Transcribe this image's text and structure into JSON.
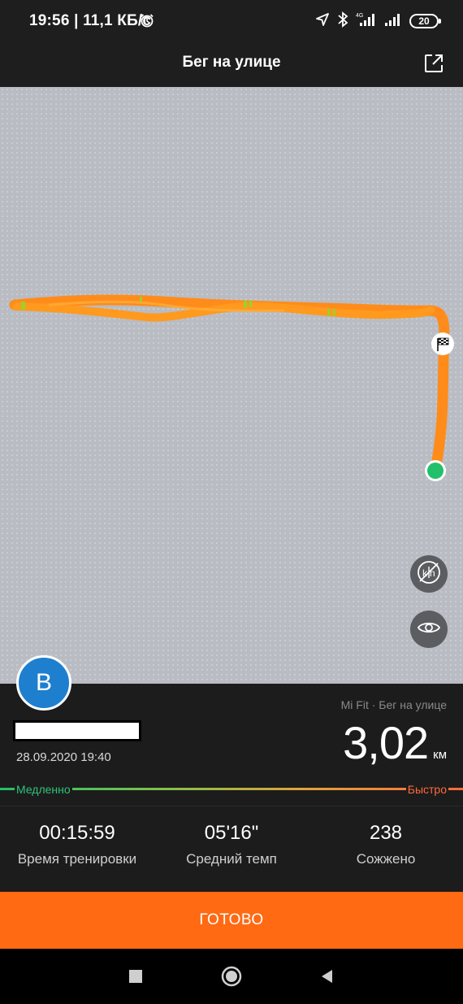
{
  "status_bar": {
    "time": "19:56 | 11,1 КБ/с",
    "battery": "20",
    "icons": [
      "alarm-icon",
      "location-icon",
      "bluetooth-icon",
      "signal-4g-icon",
      "signal-icon",
      "battery-icon"
    ]
  },
  "header": {
    "title": "Бег на улице",
    "share_icon": "share-icon"
  },
  "map": {
    "route_color": "#ff8c1a",
    "start_marker_color": "#22c06a",
    "finish_icon": "checkered-flag-icon",
    "buttons": [
      {
        "icon": "km-markers-off-icon"
      },
      {
        "icon": "eye-icon"
      }
    ]
  },
  "workout": {
    "avatar_letter": "B",
    "date": "28.09.2020 19:40",
    "source": "Mi Fit · Бег на улице",
    "distance": "3,02",
    "distance_unit": "км",
    "pace_slow_label": "Медленно",
    "pace_fast_label": "Быстро",
    "stats": [
      {
        "value": "00:15:59",
        "label": "Время тренировки"
      },
      {
        "value": "05'16\"",
        "label": "Средний темп"
      },
      {
        "value": "238",
        "label": "Сожжено"
      }
    ]
  },
  "done_button": "ГОТОВО",
  "nav_bar": [
    "recents-icon",
    "home-icon",
    "back-icon"
  ],
  "colors": {
    "accent": "#ff6a13",
    "avatar": "#1e7fcf",
    "slow": "#22c06a",
    "fast": "#ff6a3a"
  }
}
